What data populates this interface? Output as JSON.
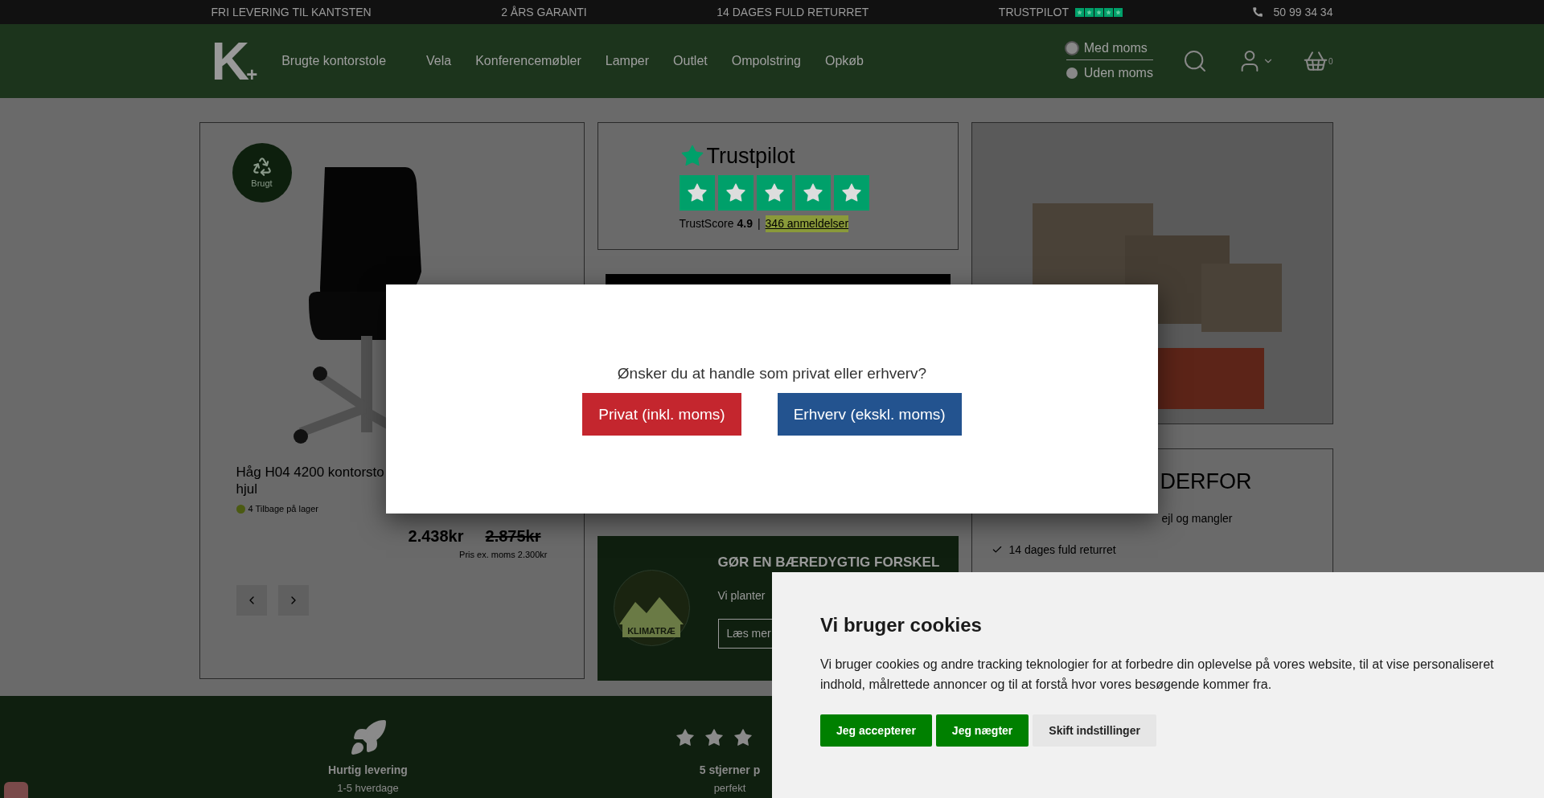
{
  "top_bar": {
    "items": [
      "FRI LEVERING TIL KANTSTEN",
      "2 ÅRS GARANTI",
      "14 DAGES FULD RETURRET"
    ],
    "trustpilot": {
      "label": "TRUSTPILOT",
      "stars": 5
    },
    "phone": "50 99 34 34"
  },
  "nav": {
    "logo": {
      "letter": "K",
      "plus": "+"
    },
    "items": [
      "Brugte kontorstole",
      "Vela",
      "Konferencemøbler",
      "Lamper",
      "Outlet",
      "Ompolstring",
      "Opkøb"
    ],
    "vat_options": [
      {
        "label": "Med moms",
        "selected": true
      },
      {
        "label": "Uden moms",
        "selected": false
      }
    ],
    "cart_count": "0"
  },
  "product": {
    "badge": "Brugt",
    "title": "Håg H04 4200 kontorsto hjul",
    "stock": {
      "text": "4 Tilbage på lager",
      "color": "#4b5a12"
    },
    "price": "2.438kr",
    "old_price": "2.875kr",
    "price_ex_vat": "Pris ex. moms 2.300kr"
  },
  "trustpilot_card": {
    "logo": "Trustpilot",
    "stars": 5,
    "score_label": "TrustScore",
    "score": "4.9",
    "separator": "|",
    "reviews": "346 anmeldelser"
  },
  "climate_card": {
    "logo_text": "KLIMATRÆ",
    "heading": "GØR EN BÆREDYGTIG FORSKEL",
    "text": "Vi planter",
    "button": "Læs mer"
  },
  "why_card": {
    "heading": "DERFOR",
    "items": [
      "ejl og mangler",
      "14 dages fuld returret"
    ]
  },
  "footer_features": [
    {
      "kind": "rocket",
      "title": "Hurtig levering",
      "subtitle": "1-5 hverdage"
    },
    {
      "kind": "stars",
      "title": "5 stjerner p",
      "subtitle": "perfekt"
    }
  ],
  "modal": {
    "question": "Ønsker du at handle som privat eller erhverv?",
    "buttons": [
      {
        "label": "Privat (inkl. moms)",
        "kind": "private"
      },
      {
        "label": "Erhverv (ekskl. moms)",
        "kind": "business"
      }
    ]
  },
  "cookie_banner": {
    "title": "Vi bruger cookies",
    "text": "Vi bruger cookies og andre tracking teknologier for at forbedre din oplevelse på vores website, til at vise personaliseret indhold, målrettede annoncer og til at forstå hvor vores besøgende kommer fra.",
    "buttons": [
      {
        "label": "Jeg accepterer",
        "kind": "primary"
      },
      {
        "label": "Jeg nægter",
        "kind": "primary"
      },
      {
        "label": "Skift indstillinger",
        "kind": "secondary"
      }
    ]
  }
}
